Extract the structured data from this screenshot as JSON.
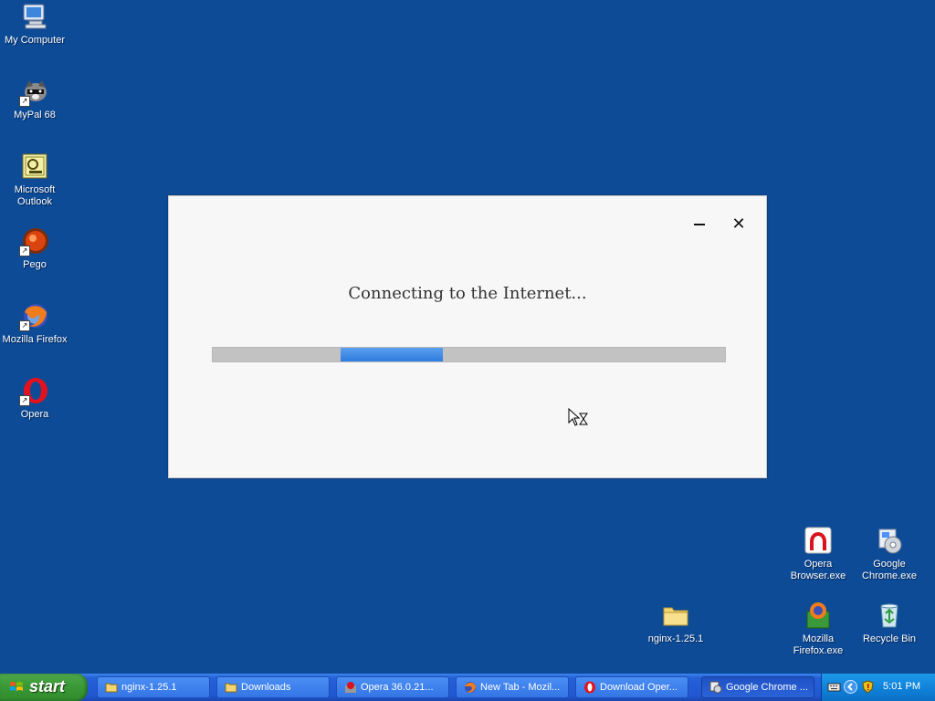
{
  "desktop": {
    "icons": [
      {
        "label": "My Computer",
        "icon": "my-computer-icon"
      },
      {
        "label": "MyPal 68",
        "icon": "mypal-icon"
      },
      {
        "label": "Microsoft\nOutlook",
        "icon": "outlook-icon"
      },
      {
        "label": "Pego",
        "icon": "pego-icon"
      },
      {
        "label": "Mozilla Firefox",
        "icon": "firefox-icon"
      },
      {
        "label": "Opera",
        "icon": "opera-icon"
      },
      {
        "label": "Opera\nBrowser.exe",
        "icon": "opera-installer-icon"
      },
      {
        "label": "Google\nChrome.exe",
        "icon": "chrome-installer-icon"
      },
      {
        "label": "nginx-1.25.1",
        "icon": "folder-icon"
      },
      {
        "label": "Mozilla\nFirefox.exe",
        "icon": "firefox-installer-icon"
      },
      {
        "label": "Recycle Bin",
        "icon": "recycle-bin-icon"
      }
    ]
  },
  "dialog": {
    "message": "Connecting to the Internet...",
    "minimize_symbol": "—",
    "close_symbol": "✕",
    "progress": {
      "start_fraction": 0.25,
      "end_fraction": 0.45,
      "indeterminate": true
    }
  },
  "taskbar": {
    "start_label": "start",
    "buttons": [
      {
        "label": "nginx-1.25.1",
        "icon": "folder-icon"
      },
      {
        "label": "Downloads",
        "icon": "folder-icon"
      },
      {
        "label": "Opera 36.0.21...",
        "icon": "opera-installer-icon"
      },
      {
        "label": "New Tab - Mozil...",
        "icon": "firefox-icon"
      },
      {
        "label": "Download Oper...",
        "icon": "opera-icon"
      },
      {
        "label": "Google Chrome ...",
        "icon": "chrome-installer-icon"
      }
    ],
    "tray": {
      "clock": "5:01 PM",
      "icons": [
        "keyboard-icon",
        "chevron-left-icon",
        "shield-icon"
      ]
    }
  },
  "colors": {
    "desktop": "#0e4b97",
    "progress_fill": "#3b86e8",
    "taskbar": "#2257d0",
    "start": "#3c9b38"
  }
}
